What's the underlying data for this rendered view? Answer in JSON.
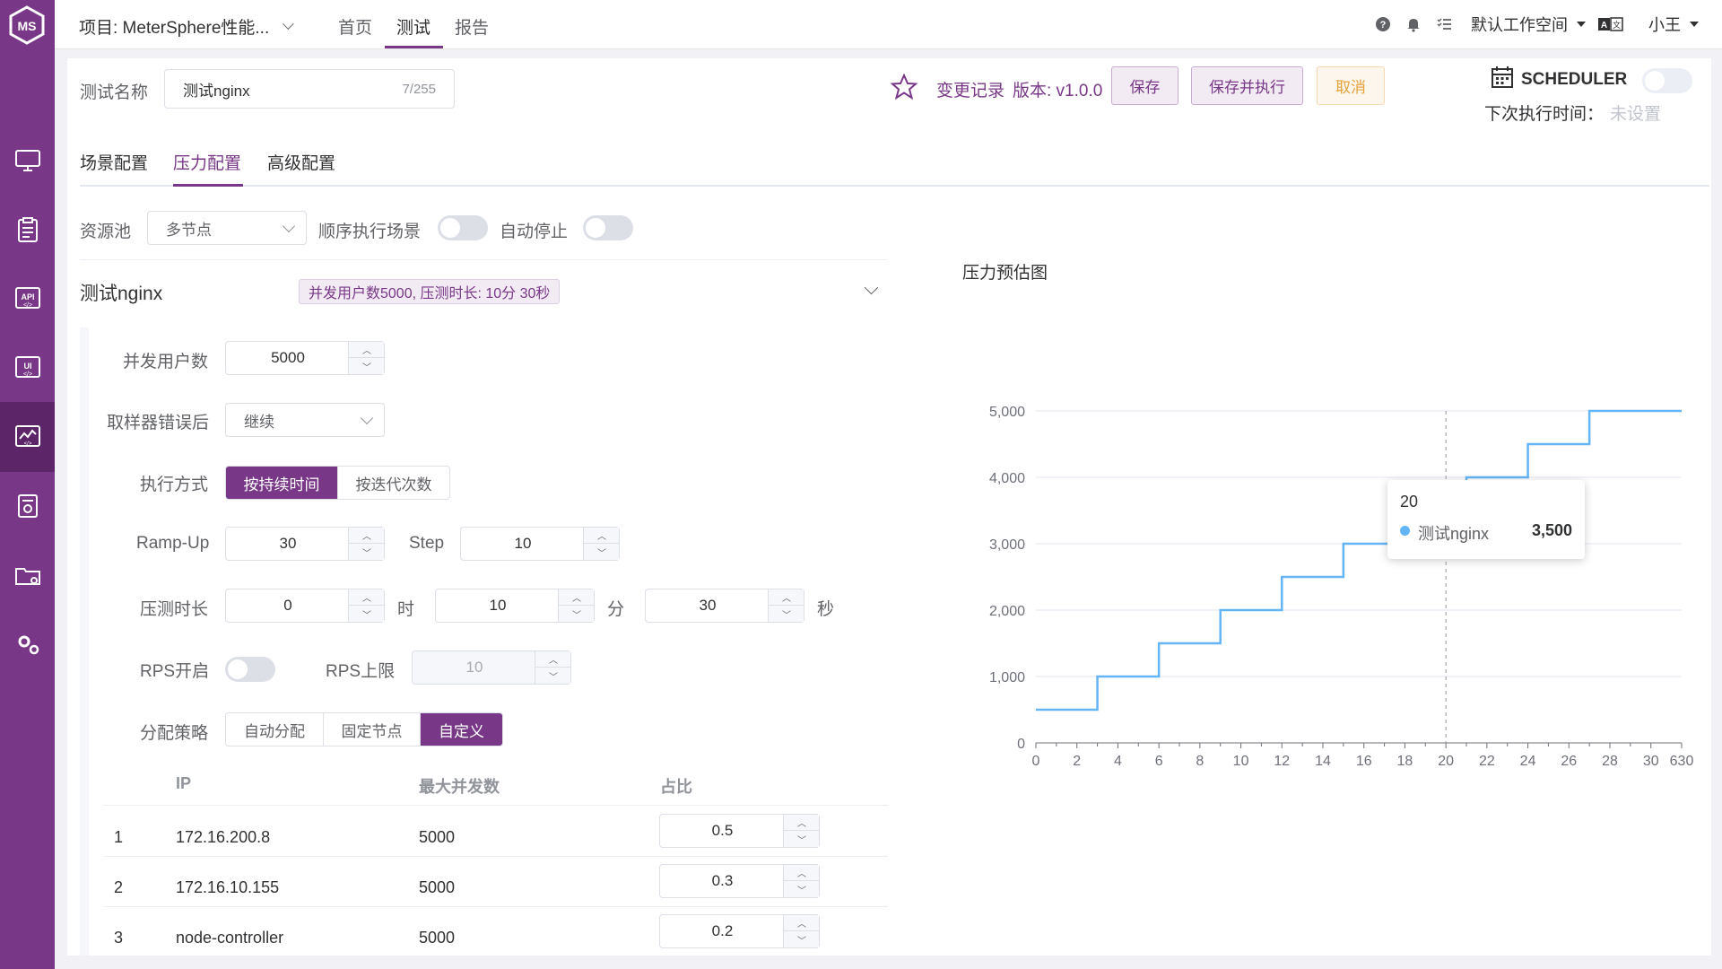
{
  "sidebar": {
    "items": [
      {
        "icon": "monitor-icon",
        "active": false
      },
      {
        "icon": "clipboard-icon",
        "active": false
      },
      {
        "icon": "api-icon",
        "active": false
      },
      {
        "icon": "ui-test-icon",
        "active": false
      },
      {
        "icon": "performance-icon",
        "active": true
      },
      {
        "icon": "report-icon",
        "active": false
      },
      {
        "icon": "folder-settings-icon",
        "active": false
      },
      {
        "icon": "gears-icon",
        "active": false
      }
    ]
  },
  "header": {
    "project": "项目: MeterSphere性能...",
    "nav": [
      "首页",
      "测试",
      "报告"
    ],
    "nav_active": "测试",
    "workspace": "默认工作空间",
    "user": "小王"
  },
  "form": {
    "name_label": "测试名称",
    "name_value": "测试nginx",
    "name_count": "7/255",
    "change_log": "变更记录",
    "version": "版本: v1.0.0",
    "save": "保存",
    "save_run": "保存并执行",
    "cancel": "取消",
    "scheduler": "SCHEDULER",
    "next_run_label": "下次执行时间：",
    "next_run_value": "未设置"
  },
  "tabs": [
    "场景配置",
    "压力配置",
    "高级配置"
  ],
  "tab_active": "压力配置",
  "pressure": {
    "pool_label": "资源池",
    "pool_value": "多节点",
    "serial_label": "顺序执行场景",
    "auto_stop_label": "自动停止",
    "scenario_name": "测试nginx",
    "summary_tag": "并发用户数5000, 压测时长: 10分 30秒",
    "users_label": "并发用户数",
    "users_value": "5000",
    "on_error_label": "取样器错误后",
    "on_error_value": "继续",
    "mode_label": "执行方式",
    "mode_options": [
      "按持续时间",
      "按迭代次数"
    ],
    "mode_active": 0,
    "rampup_label": "Ramp-Up",
    "rampup_value": "30",
    "step_label": "Step",
    "step_value": "10",
    "duration_label": "压测时长",
    "hours": "0",
    "hours_unit": "时",
    "minutes": "10",
    "minutes_unit": "分",
    "seconds": "30",
    "seconds_unit": "秒",
    "rps_label": "RPS开启",
    "rps_limit_label": "RPS上限",
    "rps_limit_value": "10",
    "strategy_label": "分配策略",
    "strategy_options": [
      "自动分配",
      "固定节点",
      "自定义"
    ],
    "strategy_active": 2,
    "table": {
      "headers": [
        "IP",
        "最大并发数",
        "占比"
      ],
      "rows": [
        {
          "idx": "1",
          "ip": "172.16.200.8",
          "max": "5000",
          "ratio": "0.5"
        },
        {
          "idx": "2",
          "ip": "172.16.10.155",
          "max": "5000",
          "ratio": "0.3"
        },
        {
          "idx": "3",
          "ip": "node-controller",
          "max": "5000",
          "ratio": "0.2"
        }
      ]
    }
  },
  "chart_data": {
    "type": "line",
    "title": "压力预估图",
    "series": [
      {
        "name": "测试nginx",
        "color": "#64b5f6",
        "step": true,
        "x": [
          0,
          3,
          6,
          9,
          12,
          15,
          18,
          21,
          24,
          27,
          30
        ],
        "y": [
          500,
          1000,
          1500,
          2000,
          2500,
          3000,
          3500,
          4000,
          4500,
          5000,
          5000
        ]
      }
    ],
    "xticks": [
      "0",
      "2",
      "4",
      "6",
      "8",
      "10",
      "12",
      "14",
      "16",
      "18",
      "20",
      "22",
      "24",
      "26",
      "28",
      "30",
      "630"
    ],
    "yticks": [
      "0",
      "1,000",
      "2,000",
      "3,000",
      "4,000",
      "5,000"
    ],
    "ylim": [
      0,
      5000
    ],
    "grid": true,
    "tooltip": {
      "x": "20",
      "series": "测试nginx",
      "value": "3,500"
    }
  }
}
